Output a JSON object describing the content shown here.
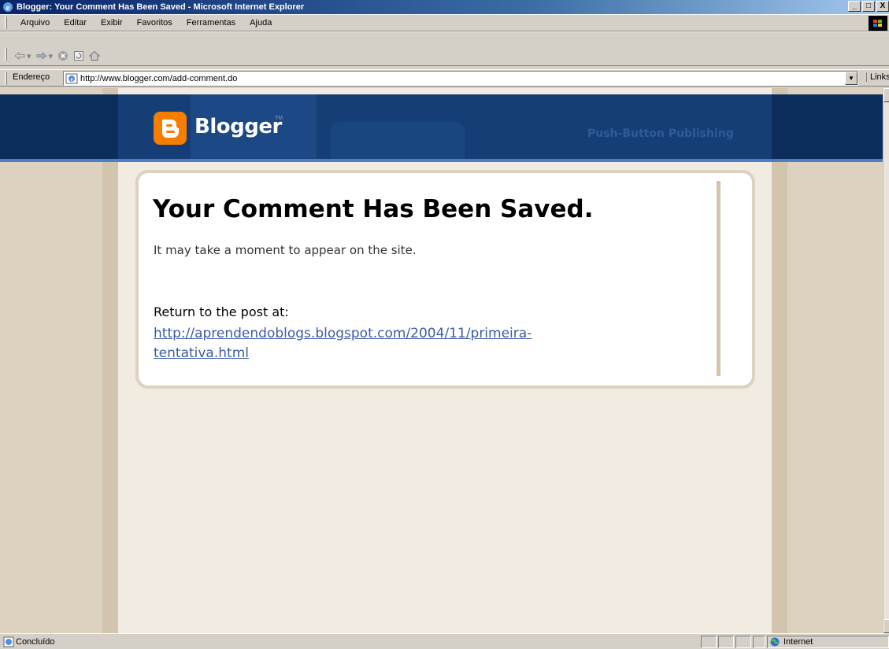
{
  "window": {
    "title": "Blogger: Your Comment Has Been Saved - Microsoft Internet Explorer",
    "controls": [
      "_",
      "□",
      "X"
    ]
  },
  "menu": [
    "Arquivo",
    "Editar",
    "Exibir",
    "Favoritos",
    "Ferramentas",
    "Ajuda"
  ],
  "address": {
    "label": "Endereço",
    "url": "http://www.blogger.com/add-comment.do",
    "links_label": "Links"
  },
  "header": {
    "logo_text": "Blogger",
    "tm": "TM",
    "tagline": "Push-Button Publishing"
  },
  "card": {
    "title": "Your Comment Has Been Saved.",
    "subtitle": "It may take a moment to appear on the site.",
    "return_label": "Return to the post at:",
    "link": "http://aprendendoblogs.blogspot.com/2004/11/primeira-tentativa.html",
    "link_line1": "http://aprendendoblogs.blogspot.com/2004/11/primeira-",
    "link_line2": "tentativa.html"
  },
  "status": {
    "text": "Concluído",
    "zone": "Internet"
  },
  "colors": {
    "brand_orange": "#f57d00",
    "header_navy": "#153e76",
    "link_blue": "#3b5ba5",
    "page_beige": "#ddd1bf"
  }
}
